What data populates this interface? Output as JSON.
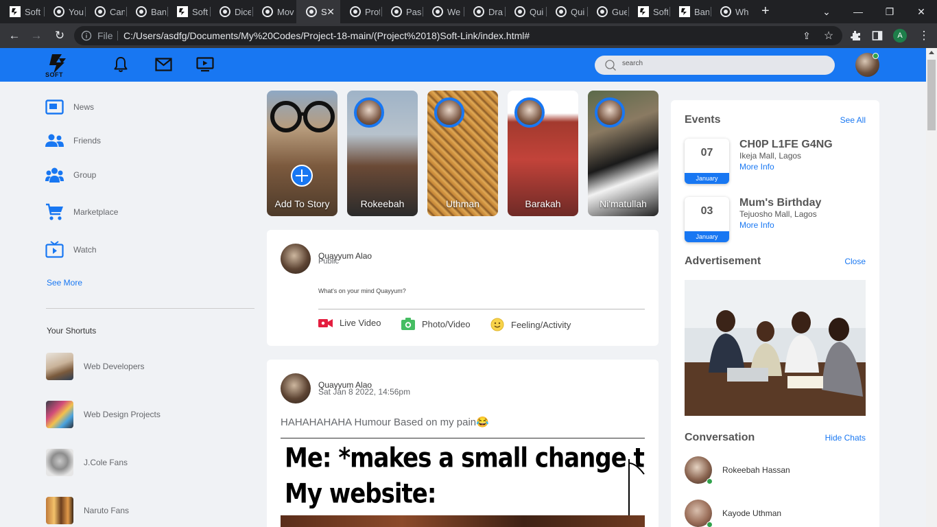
{
  "browser": {
    "tabs": [
      {
        "title": "Soft",
        "active": false
      },
      {
        "title": "You",
        "active": false
      },
      {
        "title": "Can",
        "active": false
      },
      {
        "title": "Ban",
        "active": false
      },
      {
        "title": "Soft",
        "active": false
      },
      {
        "title": "Dice",
        "active": false
      },
      {
        "title": "Mov",
        "active": false
      },
      {
        "title": "S",
        "active": true
      },
      {
        "title": "Prof",
        "active": false
      },
      {
        "title": "Pas",
        "active": false
      },
      {
        "title": "We",
        "active": false
      },
      {
        "title": "Dra",
        "active": false
      },
      {
        "title": "Qui",
        "active": false
      },
      {
        "title": "Qui",
        "active": false
      },
      {
        "title": "Gue",
        "active": false
      },
      {
        "title": "Soft",
        "active": false
      },
      {
        "title": "Ban",
        "active": false
      },
      {
        "title": "Wh",
        "active": false
      }
    ],
    "address": {
      "scheme_label": "File",
      "url": "C:/Users/asdfg/Documents/My%20Codes/Project-18-main/(Project%2018)Soft-Link/index.html#"
    },
    "profile_initial": "A"
  },
  "header": {
    "logo_text": "SOFT",
    "search_placeholder": "search"
  },
  "sidebar": {
    "items": [
      {
        "label": "News",
        "icon": "news-icon"
      },
      {
        "label": "Friends",
        "icon": "friends-icon"
      },
      {
        "label": "Group",
        "icon": "group-icon"
      },
      {
        "label": "Marketplace",
        "icon": "cart-icon"
      },
      {
        "label": "Watch",
        "icon": "watch-icon"
      }
    ],
    "see_more": "See More",
    "shortcuts_title": "Your Shortuts",
    "shortcuts": [
      {
        "label": "Web Developers"
      },
      {
        "label": "Web Design Projects"
      },
      {
        "label": "J.Cole Fans"
      },
      {
        "label": "Naruto Fans"
      }
    ]
  },
  "stories": [
    {
      "name": "Add To Story"
    },
    {
      "name": "Rokeebah"
    },
    {
      "name": "Uthman"
    },
    {
      "name": "Barakah"
    },
    {
      "name": "Ni'matullah"
    }
  ],
  "create_post": {
    "author": "Quayyum Alao",
    "audience": "Public",
    "placeholder": "What's on your mind Quayyum?",
    "actions": [
      {
        "label": "Live Video",
        "icon": "live-video-icon"
      },
      {
        "label": "Photo/Video",
        "icon": "photo-icon"
      },
      {
        "label": "Feeling/Activity",
        "icon": "feeling-icon"
      }
    ]
  },
  "post": {
    "author": "Quayyum Alao",
    "timestamp": "Sat Jan 8 2022, 14:56pm",
    "text": "HAHAHAHAHA Humour Based on my pain😂",
    "meme_line1": "Me: *makes a small change to the CSS*",
    "meme_line2": "My website:"
  },
  "right": {
    "events_title": "Events",
    "see_all": "See All",
    "events": [
      {
        "day": "07",
        "month": "January",
        "name": "CH0P L1FE G4NG",
        "place": "Ikeja Mall, Lagos",
        "more": "More Info"
      },
      {
        "day": "03",
        "month": "January",
        "name": "Mum's Birthday",
        "place": "Tejuosho Mall, Lagos",
        "more": "More Info"
      }
    ],
    "ad_title": "Advertisement",
    "ad_close": "Close",
    "convo_title": "Conversation",
    "hide_chats": "Hide Chats",
    "conversations": [
      {
        "name": "Rokeebah Hassan"
      },
      {
        "name": "Kayode Uthman"
      }
    ]
  },
  "colors": {
    "brand": "#1877f2",
    "page_bg": "#f0f2f5",
    "online": "#31a24c"
  }
}
